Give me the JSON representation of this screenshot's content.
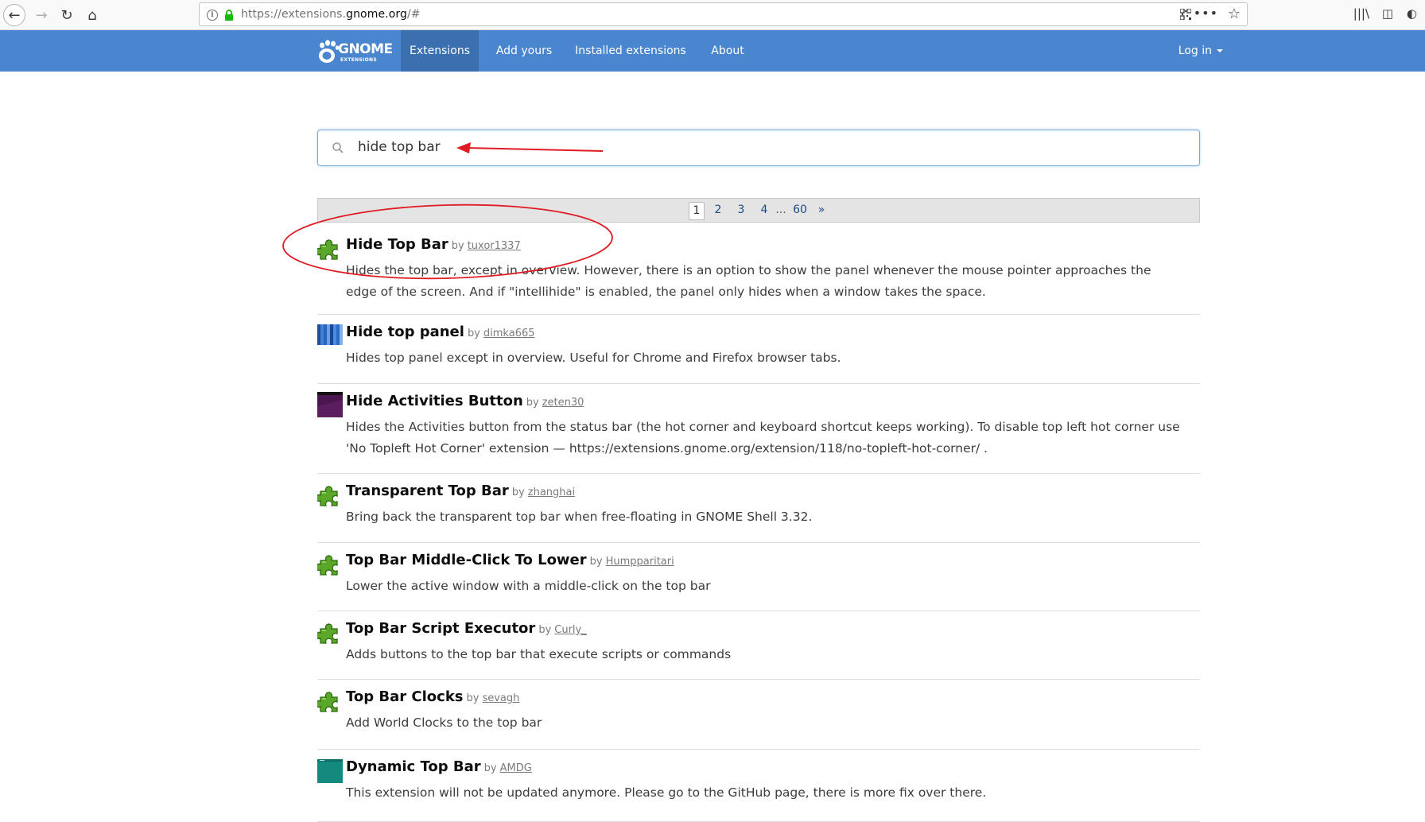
{
  "browser": {
    "url_prefix": "https://extensions.",
    "url_domain": "gnome.org",
    "url_suffix": "/#"
  },
  "navbar": {
    "brand": "GNOME",
    "brand_sub": "EXTENSIONS",
    "links": [
      "Extensions",
      "Add yours",
      "Installed extensions",
      "About"
    ],
    "active": "Extensions",
    "login": "Log in"
  },
  "search": {
    "value": "hide top bar"
  },
  "paginator": {
    "pages": [
      "1",
      "2",
      "3",
      "4",
      "...",
      "60",
      "»"
    ],
    "current": "1"
  },
  "results": [
    {
      "title": "Hide Top Bar",
      "by": "by",
      "author": "tuxor1337",
      "icon": "puzzle-icon",
      "description": "Hides the top bar, except in overview. However, there is an option to show the panel whenever the mouse pointer approaches the edge of the screen. And if \"intellihide\" is enabled, the panel only hides when a window takes the space."
    },
    {
      "title": "Hide top panel",
      "by": "by",
      "author": "dimka665",
      "icon": "blue-stripes-icon",
      "description": "Hides top panel except in overview. Useful for Chrome and Firefox browser tabs."
    },
    {
      "title": "Hide Activities Button",
      "by": "by",
      "author": "zeten30",
      "icon": "dark-purple-icon",
      "description": "Hides the Activities button from the status bar (the hot corner and keyboard shortcut keeps working). To disable top left hot corner use 'No Topleft Hot Corner' extension — https://extensions.gnome.org/extension/118/no-topleft-hot-corner/ ."
    },
    {
      "title": "Transparent Top Bar",
      "by": "by",
      "author": "zhanghai",
      "icon": "puzzle-icon",
      "description": "Bring back the transparent top bar when free-floating in GNOME Shell 3.32."
    },
    {
      "title": "Top Bar Middle-Click To Lower",
      "by": "by",
      "author": "Humpparitari",
      "icon": "puzzle-icon",
      "description": "Lower the active window with a middle-click on the top bar"
    },
    {
      "title": "Top Bar Script Executor",
      "by": "by",
      "author": "Curly_",
      "icon": "puzzle-icon",
      "description": "Adds buttons to the top bar that execute scripts or commands"
    },
    {
      "title": "Top Bar Clocks",
      "by": "by",
      "author": "sevagh",
      "icon": "puzzle-icon",
      "description": "Add World Clocks to the top bar"
    },
    {
      "title": "Dynamic Top Bar",
      "by": "by",
      "author": "AMDG",
      "icon": "teal-screenshot-icon",
      "description": "This extension will not be updated anymore. Please go to the GitHub page, there is more fix over there."
    }
  ],
  "colors": {
    "navbar": "#4a86cf",
    "navbar_active": "#3a6fb0",
    "puzzle_green": "#4e9a06",
    "annotation_red": "#e01b24"
  }
}
